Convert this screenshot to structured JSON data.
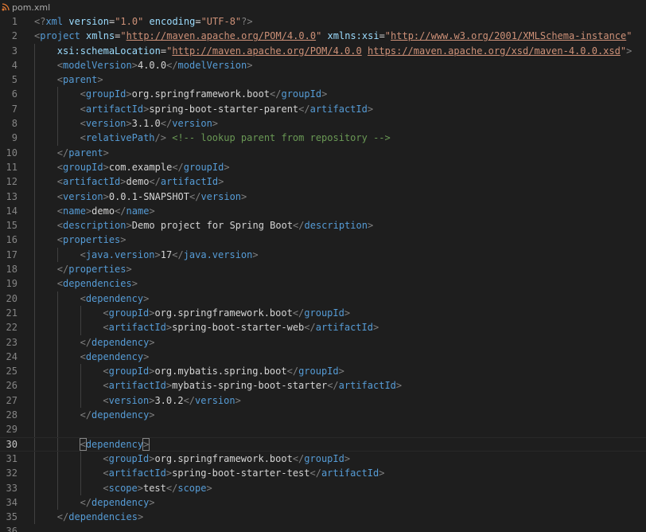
{
  "tab": {
    "filename": "pom.xml",
    "icon": "rss-xml-file-icon"
  },
  "colors": {
    "background": "#1e1e1e",
    "tag": "#569cd6",
    "bracket": "#808080",
    "attribute": "#9cdcfe",
    "string": "#ce9178",
    "comment": "#6a9955",
    "text": "#d4d4d4",
    "line_number": "#858585"
  },
  "editor": {
    "current_line": 30,
    "lines": [
      {
        "n": "1",
        "indent": 0,
        "tokens": [
          [
            "pi",
            "<?"
          ],
          [
            "tag",
            "xml"
          ],
          [
            "txt",
            " "
          ],
          [
            "attr",
            "version"
          ],
          [
            "txt",
            "="
          ],
          [
            "str",
            "\"1.0\""
          ],
          [
            "txt",
            " "
          ],
          [
            "attr",
            "encoding"
          ],
          [
            "txt",
            "="
          ],
          [
            "str",
            "\"UTF-8\""
          ],
          [
            "pi",
            "?>"
          ]
        ]
      },
      {
        "n": "2",
        "indent": 0,
        "tokens": [
          [
            "br",
            "<"
          ],
          [
            "tag",
            "project"
          ],
          [
            "txt",
            " "
          ],
          [
            "attr",
            "xmlns"
          ],
          [
            "txt",
            "="
          ],
          [
            "str",
            "\""
          ],
          [
            "link",
            "http://maven.apache.org/POM/4.0.0"
          ],
          [
            "str",
            "\""
          ],
          [
            "txt",
            " "
          ],
          [
            "attr",
            "xmlns:xsi"
          ],
          [
            "txt",
            "="
          ],
          [
            "str",
            "\""
          ],
          [
            "link",
            "http://www.w3.org/2001/XMLSchema-instance"
          ],
          [
            "str",
            "\""
          ]
        ]
      },
      {
        "n": "3",
        "indent": 1,
        "tokens": [
          [
            "attr",
            "xsi:schemaLocation"
          ],
          [
            "txt",
            "="
          ],
          [
            "str",
            "\""
          ],
          [
            "link",
            "http://maven.apache.org/POM/4.0.0"
          ],
          [
            "str",
            " "
          ],
          [
            "link",
            "https://maven.apache.org/xsd/maven-4.0.0.xsd"
          ],
          [
            "str",
            "\""
          ],
          [
            "br",
            ">"
          ]
        ]
      },
      {
        "n": "4",
        "indent": 1,
        "tokens": [
          [
            "br",
            "<"
          ],
          [
            "tag",
            "modelVersion"
          ],
          [
            "br",
            ">"
          ],
          [
            "txt",
            "4.0.0"
          ],
          [
            "br",
            "</"
          ],
          [
            "tag",
            "modelVersion"
          ],
          [
            "br",
            ">"
          ]
        ]
      },
      {
        "n": "5",
        "indent": 1,
        "tokens": [
          [
            "br",
            "<"
          ],
          [
            "tag",
            "parent"
          ],
          [
            "br",
            ">"
          ]
        ]
      },
      {
        "n": "6",
        "indent": 2,
        "tokens": [
          [
            "br",
            "<"
          ],
          [
            "tag",
            "groupId"
          ],
          [
            "br",
            ">"
          ],
          [
            "txt",
            "org.springframework.boot"
          ],
          [
            "br",
            "</"
          ],
          [
            "tag",
            "groupId"
          ],
          [
            "br",
            ">"
          ]
        ]
      },
      {
        "n": "7",
        "indent": 2,
        "tokens": [
          [
            "br",
            "<"
          ],
          [
            "tag",
            "artifactId"
          ],
          [
            "br",
            ">"
          ],
          [
            "txt",
            "spring-boot-starter-parent"
          ],
          [
            "br",
            "</"
          ],
          [
            "tag",
            "artifactId"
          ],
          [
            "br",
            ">"
          ]
        ]
      },
      {
        "n": "8",
        "indent": 2,
        "tokens": [
          [
            "br",
            "<"
          ],
          [
            "tag",
            "version"
          ],
          [
            "br",
            ">"
          ],
          [
            "txt",
            "3.1.0"
          ],
          [
            "br",
            "</"
          ],
          [
            "tag",
            "version"
          ],
          [
            "br",
            ">"
          ]
        ]
      },
      {
        "n": "9",
        "indent": 2,
        "tokens": [
          [
            "br",
            "<"
          ],
          [
            "tag",
            "relativePath"
          ],
          [
            "br",
            "/>"
          ],
          [
            "txt",
            " "
          ],
          [
            "cmt",
            "<!-- lookup parent from repository -->"
          ]
        ]
      },
      {
        "n": "10",
        "indent": 1,
        "tokens": [
          [
            "br",
            "</"
          ],
          [
            "tag",
            "parent"
          ],
          [
            "br",
            ">"
          ]
        ]
      },
      {
        "n": "11",
        "indent": 1,
        "tokens": [
          [
            "br",
            "<"
          ],
          [
            "tag",
            "groupId"
          ],
          [
            "br",
            ">"
          ],
          [
            "txt",
            "com.example"
          ],
          [
            "br",
            "</"
          ],
          [
            "tag",
            "groupId"
          ],
          [
            "br",
            ">"
          ]
        ]
      },
      {
        "n": "12",
        "indent": 1,
        "tokens": [
          [
            "br",
            "<"
          ],
          [
            "tag",
            "artifactId"
          ],
          [
            "br",
            ">"
          ],
          [
            "txt",
            "demo"
          ],
          [
            "br",
            "</"
          ],
          [
            "tag",
            "artifactId"
          ],
          [
            "br",
            ">"
          ]
        ]
      },
      {
        "n": "13",
        "indent": 1,
        "tokens": [
          [
            "br",
            "<"
          ],
          [
            "tag",
            "version"
          ],
          [
            "br",
            ">"
          ],
          [
            "txt",
            "0.0.1-SNAPSHOT"
          ],
          [
            "br",
            "</"
          ],
          [
            "tag",
            "version"
          ],
          [
            "br",
            ">"
          ]
        ]
      },
      {
        "n": "14",
        "indent": 1,
        "tokens": [
          [
            "br",
            "<"
          ],
          [
            "tag",
            "name"
          ],
          [
            "br",
            ">"
          ],
          [
            "txt",
            "demo"
          ],
          [
            "br",
            "</"
          ],
          [
            "tag",
            "name"
          ],
          [
            "br",
            ">"
          ]
        ]
      },
      {
        "n": "15",
        "indent": 1,
        "tokens": [
          [
            "br",
            "<"
          ],
          [
            "tag",
            "description"
          ],
          [
            "br",
            ">"
          ],
          [
            "txt",
            "Demo project for Spring Boot"
          ],
          [
            "br",
            "</"
          ],
          [
            "tag",
            "description"
          ],
          [
            "br",
            ">"
          ]
        ]
      },
      {
        "n": "16",
        "indent": 1,
        "tokens": [
          [
            "br",
            "<"
          ],
          [
            "tag",
            "properties"
          ],
          [
            "br",
            ">"
          ]
        ]
      },
      {
        "n": "17",
        "indent": 2,
        "tokens": [
          [
            "br",
            "<"
          ],
          [
            "tag",
            "java.version"
          ],
          [
            "br",
            ">"
          ],
          [
            "txt",
            "17"
          ],
          [
            "br",
            "</"
          ],
          [
            "tag",
            "java.version"
          ],
          [
            "br",
            ">"
          ]
        ]
      },
      {
        "n": "18",
        "indent": 1,
        "tokens": [
          [
            "br",
            "</"
          ],
          [
            "tag",
            "properties"
          ],
          [
            "br",
            ">"
          ]
        ]
      },
      {
        "n": "19",
        "indent": 1,
        "tokens": [
          [
            "br",
            "<"
          ],
          [
            "tag",
            "dependencies"
          ],
          [
            "br",
            ">"
          ]
        ]
      },
      {
        "n": "20",
        "indent": 2,
        "tokens": [
          [
            "br",
            "<"
          ],
          [
            "tag",
            "dependency"
          ],
          [
            "br",
            ">"
          ]
        ]
      },
      {
        "n": "21",
        "indent": 3,
        "tokens": [
          [
            "br",
            "<"
          ],
          [
            "tag",
            "groupId"
          ],
          [
            "br",
            ">"
          ],
          [
            "txt",
            "org.springframework.boot"
          ],
          [
            "br",
            "</"
          ],
          [
            "tag",
            "groupId"
          ],
          [
            "br",
            ">"
          ]
        ]
      },
      {
        "n": "22",
        "indent": 3,
        "tokens": [
          [
            "br",
            "<"
          ],
          [
            "tag",
            "artifactId"
          ],
          [
            "br",
            ">"
          ],
          [
            "txt",
            "spring-boot-starter-web"
          ],
          [
            "br",
            "</"
          ],
          [
            "tag",
            "artifactId"
          ],
          [
            "br",
            ">"
          ]
        ]
      },
      {
        "n": "23",
        "indent": 2,
        "tokens": [
          [
            "br",
            "</"
          ],
          [
            "tag",
            "dependency"
          ],
          [
            "br",
            ">"
          ]
        ]
      },
      {
        "n": "24",
        "indent": 2,
        "tokens": [
          [
            "br",
            "<"
          ],
          [
            "tag",
            "dependency"
          ],
          [
            "br",
            ">"
          ]
        ]
      },
      {
        "n": "25",
        "indent": 3,
        "tokens": [
          [
            "br",
            "<"
          ],
          [
            "tag",
            "groupId"
          ],
          [
            "br",
            ">"
          ],
          [
            "txt",
            "org.mybatis.spring.boot"
          ],
          [
            "br",
            "</"
          ],
          [
            "tag",
            "groupId"
          ],
          [
            "br",
            ">"
          ]
        ]
      },
      {
        "n": "26",
        "indent": 3,
        "tokens": [
          [
            "br",
            "<"
          ],
          [
            "tag",
            "artifactId"
          ],
          [
            "br",
            ">"
          ],
          [
            "txt",
            "mybatis-spring-boot-starter"
          ],
          [
            "br",
            "</"
          ],
          [
            "tag",
            "artifactId"
          ],
          [
            "br",
            ">"
          ]
        ]
      },
      {
        "n": "27",
        "indent": 3,
        "tokens": [
          [
            "br",
            "<"
          ],
          [
            "tag",
            "version"
          ],
          [
            "br",
            ">"
          ],
          [
            "txt",
            "3.0.2"
          ],
          [
            "br",
            "</"
          ],
          [
            "tag",
            "version"
          ],
          [
            "br",
            ">"
          ]
        ]
      },
      {
        "n": "28",
        "indent": 2,
        "tokens": [
          [
            "br",
            "</"
          ],
          [
            "tag",
            "dependency"
          ],
          [
            "br",
            ">"
          ]
        ]
      },
      {
        "n": "29",
        "indent": 0,
        "tokens": []
      },
      {
        "n": "30",
        "indent": 2,
        "tokens": [
          [
            "brm",
            "<"
          ],
          [
            "tag",
            "dependency"
          ],
          [
            "brm",
            ">"
          ]
        ]
      },
      {
        "n": "31",
        "indent": 3,
        "tokens": [
          [
            "br",
            "<"
          ],
          [
            "tag",
            "groupId"
          ],
          [
            "br",
            ">"
          ],
          [
            "txt",
            "org.springframework.boot"
          ],
          [
            "br",
            "</"
          ],
          [
            "tag",
            "groupId"
          ],
          [
            "br",
            ">"
          ]
        ]
      },
      {
        "n": "32",
        "indent": 3,
        "tokens": [
          [
            "br",
            "<"
          ],
          [
            "tag",
            "artifactId"
          ],
          [
            "br",
            ">"
          ],
          [
            "txt",
            "spring-boot-starter-test"
          ],
          [
            "br",
            "</"
          ],
          [
            "tag",
            "artifactId"
          ],
          [
            "br",
            ">"
          ]
        ]
      },
      {
        "n": "33",
        "indent": 3,
        "tokens": [
          [
            "br",
            "<"
          ],
          [
            "tag",
            "scope"
          ],
          [
            "br",
            ">"
          ],
          [
            "txt",
            "test"
          ],
          [
            "br",
            "</"
          ],
          [
            "tag",
            "scope"
          ],
          [
            "br",
            ">"
          ]
        ]
      },
      {
        "n": "34",
        "indent": 2,
        "tokens": [
          [
            "br",
            "</"
          ],
          [
            "tag",
            "dependency"
          ],
          [
            "br",
            ">"
          ]
        ]
      },
      {
        "n": "35",
        "indent": 1,
        "tokens": [
          [
            "br",
            "</"
          ],
          [
            "tag",
            "dependencies"
          ],
          [
            "br",
            ">"
          ]
        ]
      },
      {
        "n": "36",
        "indent": 0,
        "tokens": []
      }
    ]
  }
}
